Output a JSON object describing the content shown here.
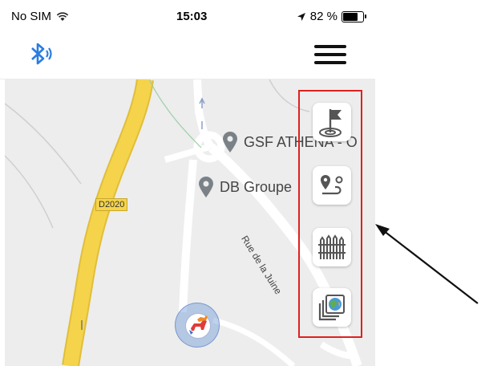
{
  "status_bar": {
    "carrier": "No SIM",
    "time": "15:03",
    "battery_percent": "82 %",
    "battery_level": 0.82
  },
  "header": {
    "left_icon": "bluetooth-icon",
    "right_icon": "hamburger-menu-icon"
  },
  "map": {
    "pois": [
      {
        "label": "GSF ATHENA - O",
        "icon": "map-pin-icon"
      },
      {
        "label": "DB Groupe",
        "icon": "map-pin-icon"
      }
    ],
    "road_badge": "D2020",
    "street_label": "Rue de la Juine",
    "pet_marker_icon": "pet-marker-icon"
  },
  "map_tools": [
    {
      "name": "flag-target-icon"
    },
    {
      "name": "route-icon"
    },
    {
      "name": "fence-icon"
    },
    {
      "name": "map-layers-icon"
    }
  ],
  "colors": {
    "bluetooth_blue": "#2a7de1",
    "highlight_red": "#e02020",
    "road_yellow": "#f5d44c",
    "poi_gray": "#7a8288"
  }
}
